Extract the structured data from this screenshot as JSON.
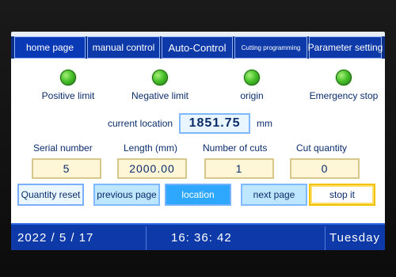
{
  "tabs": [
    {
      "label": "home page",
      "size": "normal"
    },
    {
      "label": "manual control",
      "size": "normal"
    },
    {
      "label": "Auto-Control",
      "size": "med"
    },
    {
      "label": "Cutting programming",
      "size": "small"
    },
    {
      "label": "Parameter setting",
      "size": "normal"
    }
  ],
  "indicators": [
    {
      "label": "Positive limit",
      "state": "on",
      "color": "#48c22a"
    },
    {
      "label": "Negative limit",
      "state": "on",
      "color": "#48c22a"
    },
    {
      "label": "origin",
      "state": "on",
      "color": "#48c22a"
    },
    {
      "label": "Emergency stop",
      "state": "on",
      "color": "#48c22a"
    }
  ],
  "current_location": {
    "label": "current location",
    "value": "1851.75",
    "unit": "mm"
  },
  "fields": [
    {
      "label": "Serial number",
      "value": "5"
    },
    {
      "label": "Length (mm)",
      "value": "2000.00"
    },
    {
      "label": "Number of cuts",
      "value": "1"
    },
    {
      "label": "Cut quantity",
      "value": "0"
    }
  ],
  "buttons": [
    {
      "label": "Quantity reset",
      "style": "outline"
    },
    {
      "label": "previous page",
      "style": "normal"
    },
    {
      "label": "location",
      "style": "active"
    },
    {
      "label": "next page",
      "style": "normal"
    },
    {
      "label": "stop it",
      "style": "stop"
    }
  ],
  "status_bar": {
    "date": "2022 / 5 / 17",
    "time": "16: 36: 42",
    "weekday": "Tuesday"
  },
  "colors": {
    "accent": "#0d3aa8",
    "panel": "#ffffff",
    "led_on": "#48c22a",
    "field_bg": "#fff6d8",
    "button_bg": "#bde6ff",
    "button_active": "#2ea7ff",
    "stop_border": "#f2c200"
  }
}
